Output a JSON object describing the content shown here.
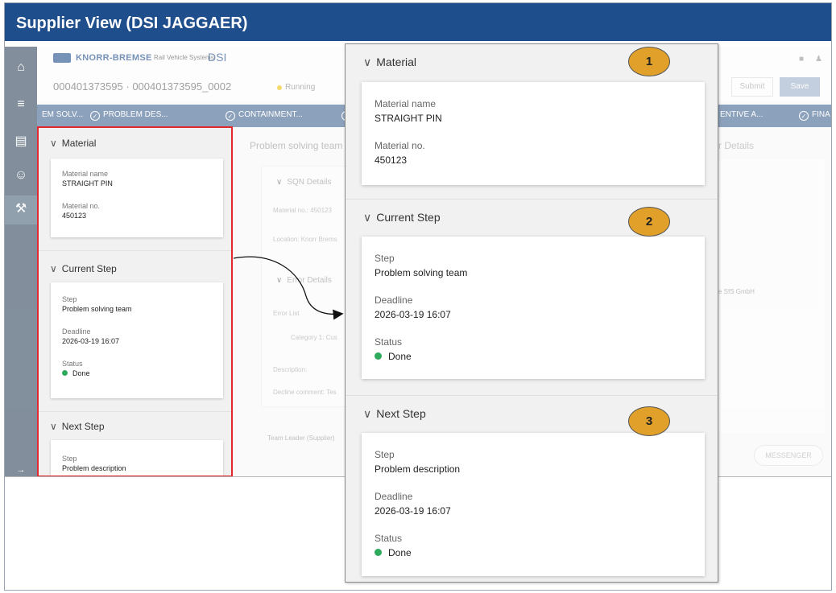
{
  "slide": {
    "title": "Supplier View (DSI JAGGAER)"
  },
  "app": {
    "brand": "KNORR-BREMSE",
    "brand_sub": "Rail Vehicle Systems",
    "product": "DSI",
    "case_id": "000401373595 · 000401373595_0002",
    "status": "Running",
    "submit_label": "Submit",
    "save_label": "Save",
    "steps": [
      "EM SOLV...",
      "PROBLEM DES...",
      "CONTAINMENT...",
      "ENTIVE A...",
      "FINA"
    ],
    "nav_icons": [
      "home-icon",
      "database-icon",
      "documents-icon",
      "user-hand-icon",
      "wrench-icon",
      "expand-arrow-icon"
    ]
  },
  "background": {
    "problem_solving_team": "Problem solving team",
    "sqn_details": "SQN Details",
    "material_no": "Material no.: 450123",
    "location": "Location: Knorr Brems",
    "error_details": "Error Details",
    "error_list": "Error List",
    "category": "Category 1: Cus",
    "description": "Description:",
    "decline_comment": "Decline comment: Tes",
    "team_leader": "Team Leader (Supplier)",
    "other_details": "r Details",
    "sfs": "e SfS GmbH",
    "messenger": "MESSENGER"
  },
  "panel": {
    "material": {
      "title": "Material",
      "name_label": "Material name",
      "name_value": "STRAIGHT PIN",
      "no_label": "Material no.",
      "no_value": "450123"
    },
    "current_step": {
      "title": "Current Step",
      "step_label": "Step",
      "step_value": "Problem solving team",
      "deadline_label": "Deadline",
      "deadline_value": "2026-03-19 16:07",
      "status_label": "Status",
      "status_value": "Done"
    },
    "next_step": {
      "title": "Next Step",
      "step_label": "Step",
      "step_value": "Problem description",
      "deadline_label": "Deadline",
      "deadline_value": "2026-03-19 16:07",
      "status_label": "Status",
      "status_value": "Done"
    }
  },
  "badges": [
    "1",
    "2",
    "3"
  ],
  "colors": {
    "title_bar": "#1f4e8c",
    "highlight_frame": "#e0282e",
    "badge": "#e0a02a",
    "status_done": "#2eaa5c"
  }
}
